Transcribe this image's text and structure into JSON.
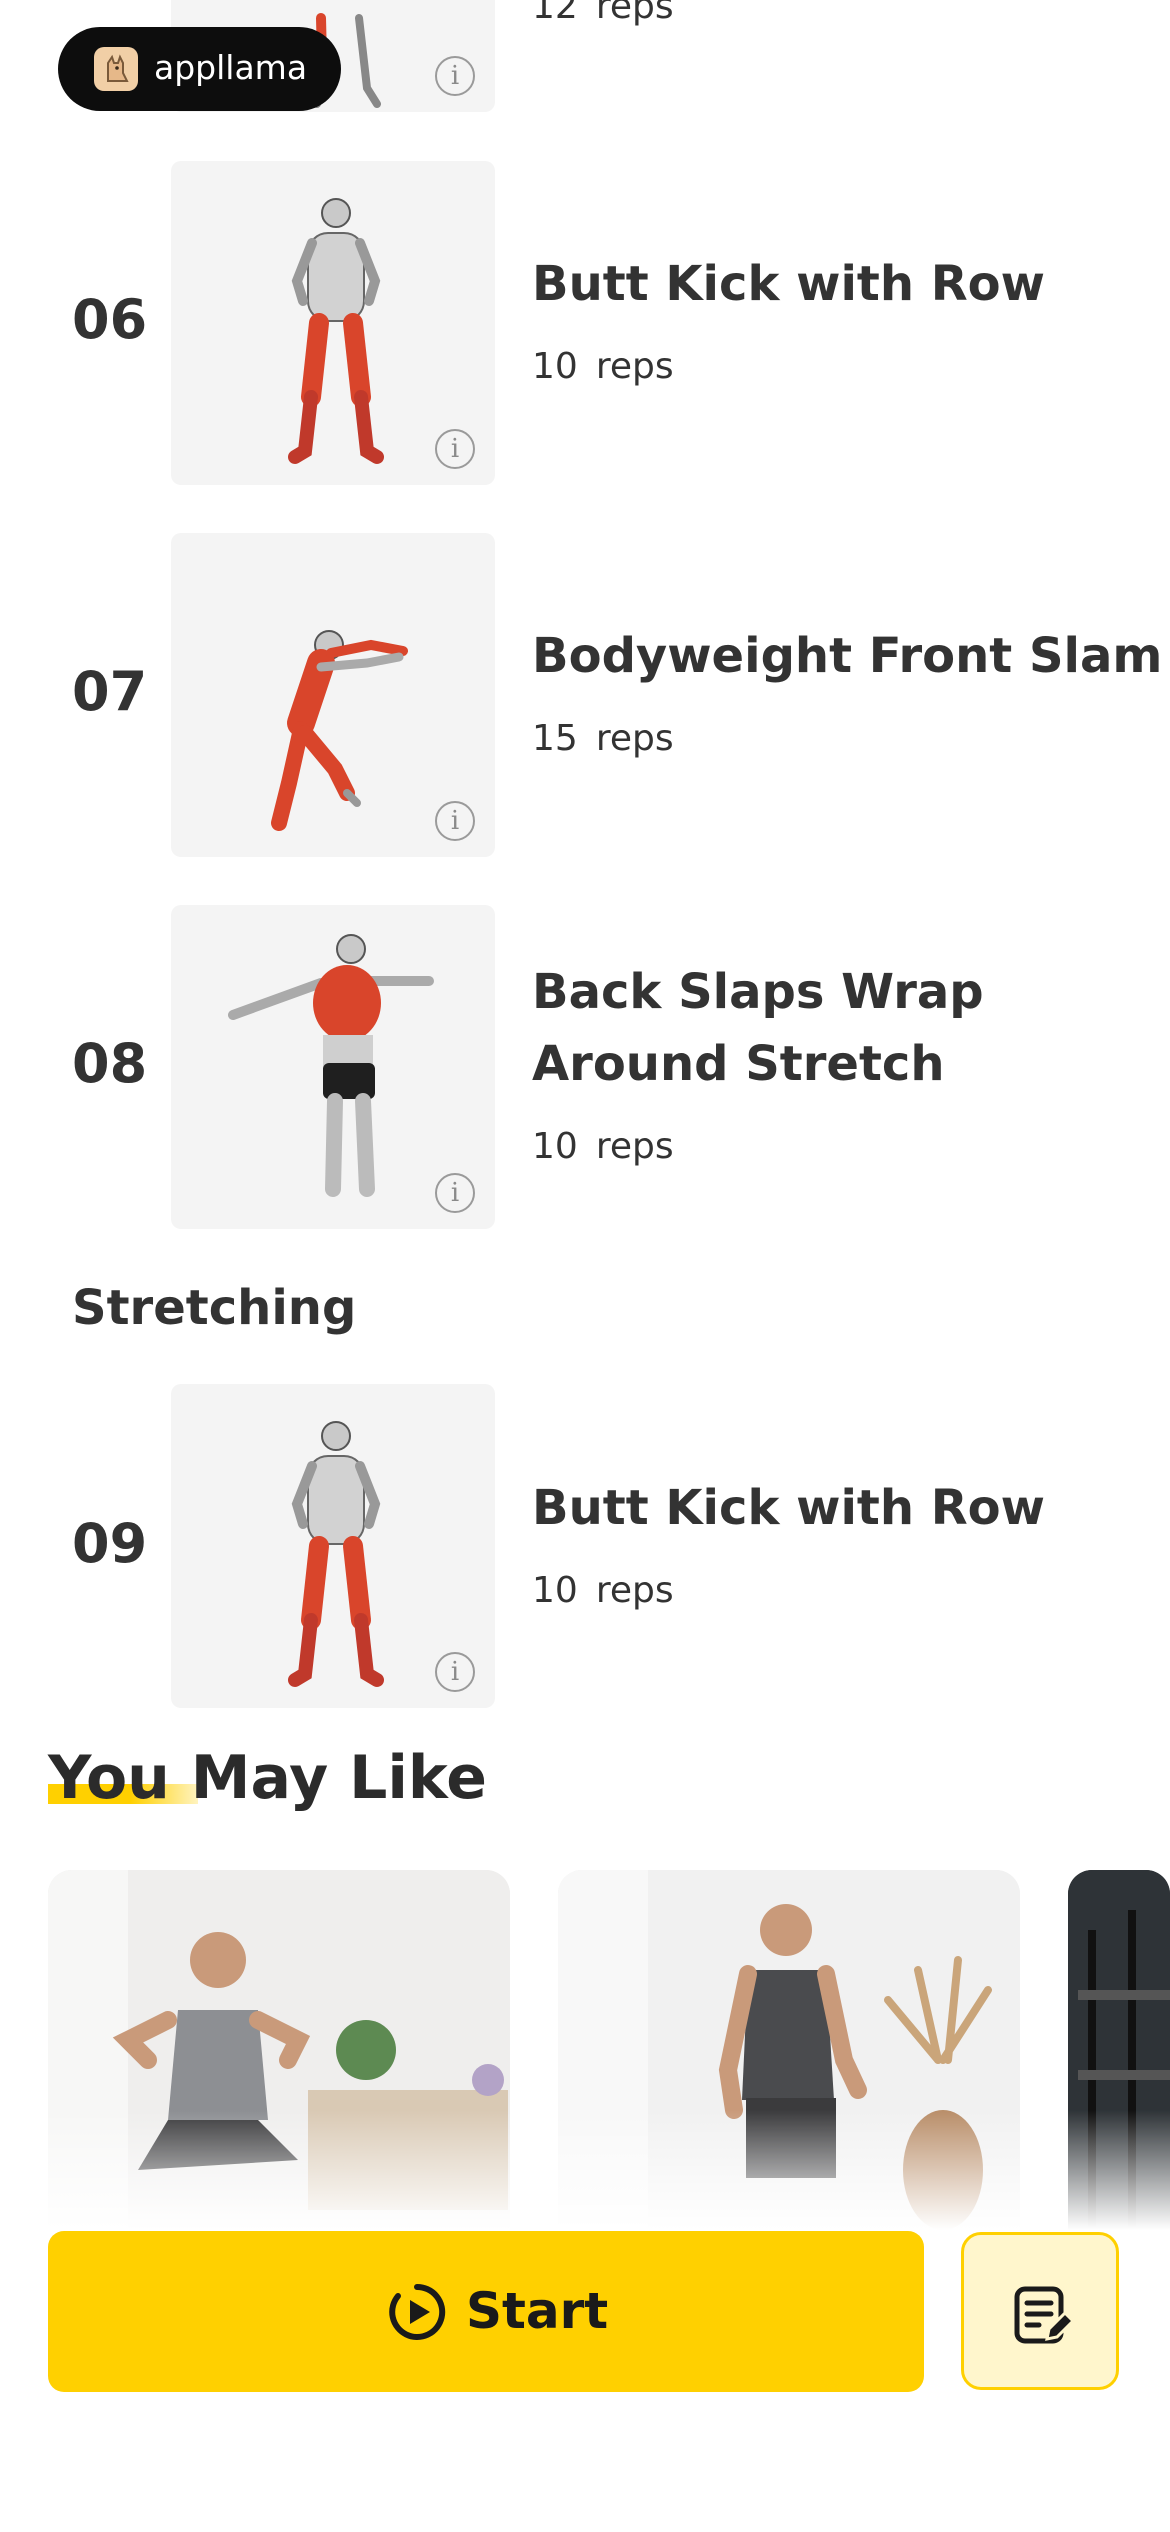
{
  "badge": {
    "label": "appllama"
  },
  "partial_top": {
    "reps_count": "12",
    "reps_unit": "reps"
  },
  "exercises": [
    {
      "number": "06",
      "name": "Butt Kick with Row",
      "reps_count": "10",
      "reps_unit": "reps"
    },
    {
      "number": "07",
      "name": "Bodyweight Front Slam",
      "reps_count": "15",
      "reps_unit": "reps"
    },
    {
      "number": "08",
      "name_line1": "Back Slaps Wrap",
      "name_line2": "Around Stretch",
      "reps_count": "10",
      "reps_unit": "reps"
    }
  ],
  "stretching": {
    "title": "Stretching",
    "exercise": {
      "number": "09",
      "name": "Butt Kick with Row",
      "reps_count": "10",
      "reps_unit": "reps"
    }
  },
  "recommend": {
    "title": "You May Like"
  },
  "actions": {
    "start_label": "Start"
  },
  "colors": {
    "accent": "#FFD000",
    "accent_light": "#FFF6CC",
    "muscle": "#d9452b",
    "text": "#333333"
  },
  "icons": [
    "appllama-logo-icon",
    "info-icon",
    "play-circle-icon",
    "edit-list-icon"
  ]
}
